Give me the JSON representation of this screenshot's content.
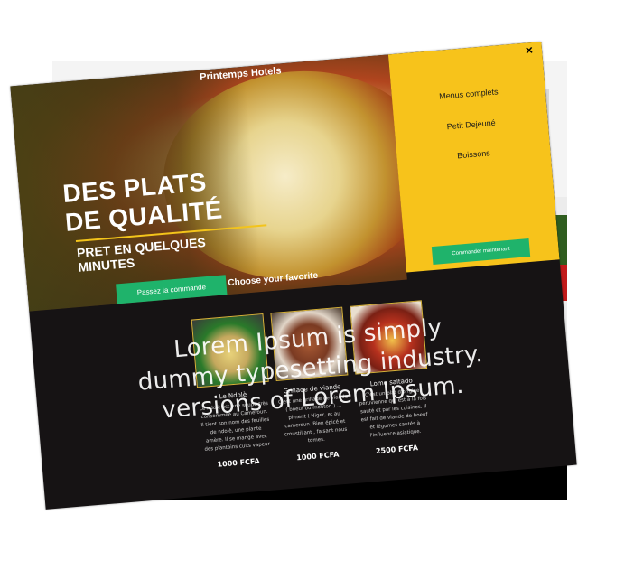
{
  "hero": {
    "brand": "Printemps Hotels",
    "headline_line1": "DES PLATS",
    "headline_line2": "DE QUALITÉ",
    "subline": "PRET EN QUELQUES MINUTES",
    "cta": "Passez la commande",
    "choose": "Choose your favorite"
  },
  "menu": {
    "close": "×",
    "items": [
      "Menus complets",
      "Petit Dejeuné",
      "Boissons"
    ],
    "order": "Commander maintenant"
  },
  "dishes": [
    {
      "name": "Le Ndolè",
      "desc": "Le ndolè est une soupe très consommée au Cameroun. Il tient son nom des feuilles de ndolè, une plante amère. Il se mange avec des plantains cuits vapeur ou frites, du bobolo de manioc et du riz blanc nature",
      "desc_visible": "Le ndolè est une soupe très · consommée au · ...",
      "price": "1000 FCFA"
    },
    {
      "name": "Grillade de viande",
      "desc": "C'est une grillade de viande ( boeuf ou mouton ) ... piment ( Niger, et au cameroun. Bien épicé et croustillant , faisant nous tomes.",
      "price": "1000 FCFA"
    },
    {
      "name": "Lomo saltado",
      "desc": "C'est un plat d'origine péruvienne qui est à la fois sauté et par les cuisines. Il est fait de viande de boeuf et légumes sautés à l'influence asiatique.",
      "price": "2500 FCFA"
    }
  ],
  "overlay": {
    "line1": "Lorem Ipsum is simply",
    "line2": "dummy typesetting industry.",
    "line3": "versions of Lorem Ipsum."
  },
  "colors": {
    "accent_yellow": "#f7c31b",
    "accent_green": "#1fb36b",
    "dark": "#161314"
  }
}
